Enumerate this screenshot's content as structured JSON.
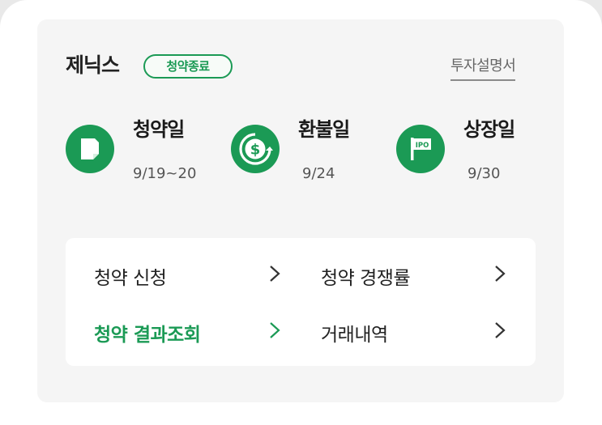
{
  "company": {
    "name": "제닉스",
    "status_badge": "청약종료",
    "prospectus_link": "투자설명서"
  },
  "steps": [
    {
      "label": "청약일",
      "date": "9/19~20",
      "icon": "document-icon"
    },
    {
      "label": "환불일",
      "date": "9/24",
      "icon": "dollar-refresh-icon"
    },
    {
      "label": "상장일",
      "date": "9/30",
      "icon": "ipo-flag-icon"
    }
  ],
  "menu": {
    "items": [
      {
        "label": "청약 신청",
        "active": false
      },
      {
        "label": "청약 경쟁률",
        "active": false
      },
      {
        "label": "청약 결과조회",
        "active": true
      },
      {
        "label": "거래내역",
        "active": false
      }
    ]
  },
  "colors": {
    "accent": "#1b9a55",
    "card_bg": "#f5f5f5",
    "text": "#222222"
  }
}
